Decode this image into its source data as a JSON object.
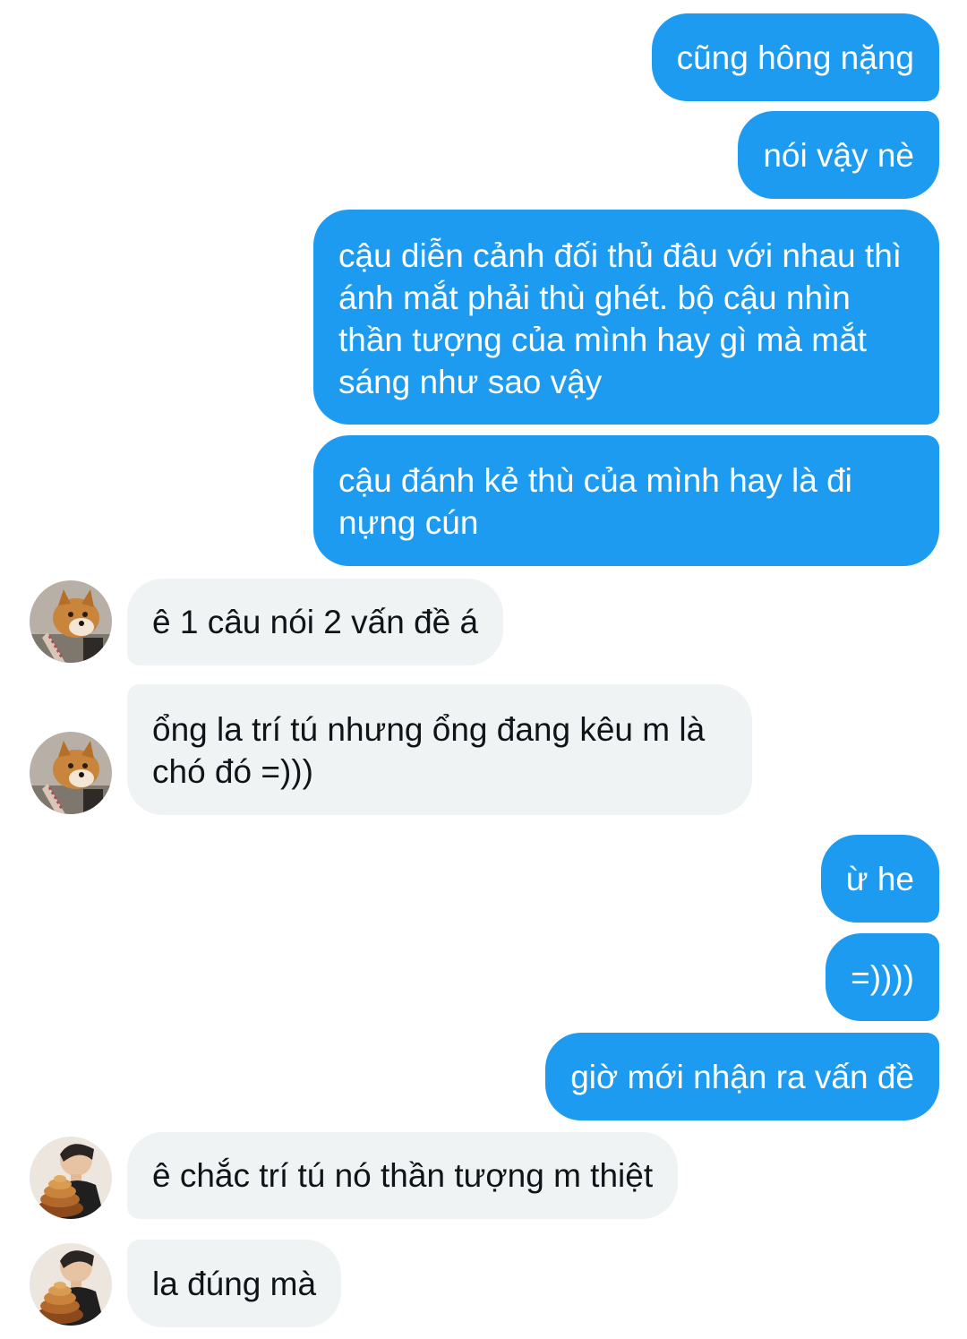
{
  "conversation": {
    "messages": [
      {
        "side": "out",
        "text": "cũng hông nặng"
      },
      {
        "side": "out",
        "text": "nói vậy nè"
      },
      {
        "side": "out",
        "text": "cậu diễn cảnh đối thủ đâu với nhau thì ánh mắt phải thù ghét. bộ cậu nhìn thần tượng của mình hay gì mà mắt sáng như sao vậy"
      },
      {
        "side": "out",
        "text": "cậu đánh kẻ thù của mình hay là đi nựng cún"
      },
      {
        "side": "in",
        "avatar": "shiba-dog-avatar",
        "text": "ê 1 câu nói 2 vấn đề á"
      },
      {
        "side": "in",
        "avatar": "shiba-dog-avatar",
        "text": "ổng la trí tú nhưng ổng đang kêu m là chó đó =)))"
      },
      {
        "side": "out",
        "text": "ừ he"
      },
      {
        "side": "out",
        "text": "=))))"
      },
      {
        "side": "out",
        "text": "giờ mới nhận ra vấn đề"
      },
      {
        "side": "in",
        "avatar": "person-with-bread-avatar",
        "text": "ê chắc trí tú nó thần tượng m thiệt"
      },
      {
        "side": "in",
        "avatar": "person-with-bread-avatar",
        "text": "la đúng mà"
      }
    ]
  },
  "colors": {
    "outgoing_bubble": "#1d9bf0",
    "incoming_bubble": "#eff3f4",
    "outgoing_text": "#ffffff",
    "incoming_text": "#0f1419"
  }
}
